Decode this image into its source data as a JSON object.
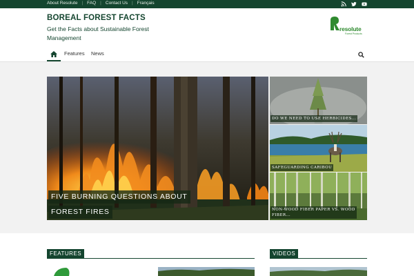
{
  "topbar": {
    "links": [
      "About Resolute",
      "FAQ",
      "Contact Us",
      "Français"
    ],
    "social": [
      "rss-icon",
      "twitter-icon",
      "youtube-icon"
    ]
  },
  "header": {
    "title": "BOREAL FOREST FACTS",
    "tagline": "Get the Facts about Sustainable Forest Management",
    "logo": {
      "word": "resolute",
      "sub": "Forest Products",
      "color": "#2f8a2f"
    }
  },
  "nav": {
    "home_icon": "home-icon",
    "items": [
      "Features",
      "News"
    ],
    "search_icon": "search-icon"
  },
  "hero": {
    "main_caption_line1": "FIVE BURNING QUESTIONS ABOUT",
    "main_caption_line2": "FOREST FIRES",
    "side": [
      {
        "caption": "DO WE NEED TO USE HERBICIDES..."
      },
      {
        "caption": "SAFEGUARDING CARIBOU"
      },
      {
        "caption_line1": "NON-WOOD FIBER PAPER VS. WOOD",
        "caption_line2": "FIBER..."
      }
    ]
  },
  "sections": {
    "features": "FEATURES",
    "videos": "VIDEOS"
  },
  "colors": {
    "brand": "#14452f",
    "accent": "#2f8a2f"
  }
}
